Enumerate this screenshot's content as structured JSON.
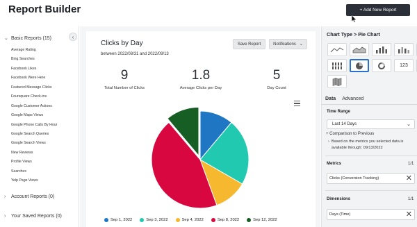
{
  "header": {
    "title": "Report Builder",
    "add_button": "+ Add New Report"
  },
  "sidebar": {
    "basic_reports": "Basic Reports (15)",
    "items": [
      "Average Rating",
      "Bing Searches",
      "Facebook Likes",
      "Facebook Were Here",
      "Featured Message Clicks",
      "Foursquare Check-ins",
      "Google Customer Actions",
      "Google Maps Views",
      "Google Phone Calls By Hour",
      "Google Search Queries",
      "Google Search Views",
      "New Reviews",
      "Profile Views",
      "Searches",
      "Yelp Page Views"
    ],
    "account_reports": "Account Reports (0)",
    "saved_reports": "Your Saved Reports (0)"
  },
  "report": {
    "title": "Clicks by Day",
    "date_range": "between 2022/08/31 and 2022/09/13",
    "save_button": "Save Report",
    "notifications_button": "Notifications",
    "stats": [
      {
        "value": "9",
        "label": "Total Number of Clicks"
      },
      {
        "value": "1.8",
        "label": "Average Clicks per Day"
      },
      {
        "value": "5",
        "label": "Day Count"
      }
    ]
  },
  "chart_data": {
    "type": "pie",
    "title": "",
    "categories": [
      "Sep 1, 2022",
      "Sep 3, 2022",
      "Sep 4, 2022",
      "Sep 8, 2022",
      "Sep 12, 2022"
    ],
    "values": [
      1,
      2,
      1,
      4,
      1
    ],
    "colors": [
      "#1f77c4",
      "#20c9b0",
      "#f5b82e",
      "#d9073f",
      "#175e24"
    ],
    "legend_position": "bottom"
  },
  "right_panel": {
    "title": "Chart Type > Pie Chart",
    "chart_types": [
      "line-chart-icon",
      "area-chart-icon",
      "bar-chart-icon",
      "stacked-bar-icon",
      "grouped-bar-icon",
      "column-chart-icon",
      "pie-chart-icon",
      "donut-chart-icon",
      "number-icon",
      "table-icon",
      "map-icon"
    ],
    "number_label": "123",
    "tabs": {
      "data": "Data",
      "advanced": "Advanced"
    },
    "time_range_label": "Time Range",
    "time_range_value": "Last 14 Days",
    "comparison": "+ Comparison to Previous",
    "note": "Based on the metrics you selected data is available through: 09/13/2022",
    "metrics_label": "Metrics",
    "metrics_count": "1/1",
    "metrics_value": "Clicks (Conversion Tracking)",
    "dimensions_label": "Dimensions",
    "dimensions_count": "1/1",
    "dimensions_value": "Days (Time)"
  },
  "accent_color": "#2a6fc9"
}
